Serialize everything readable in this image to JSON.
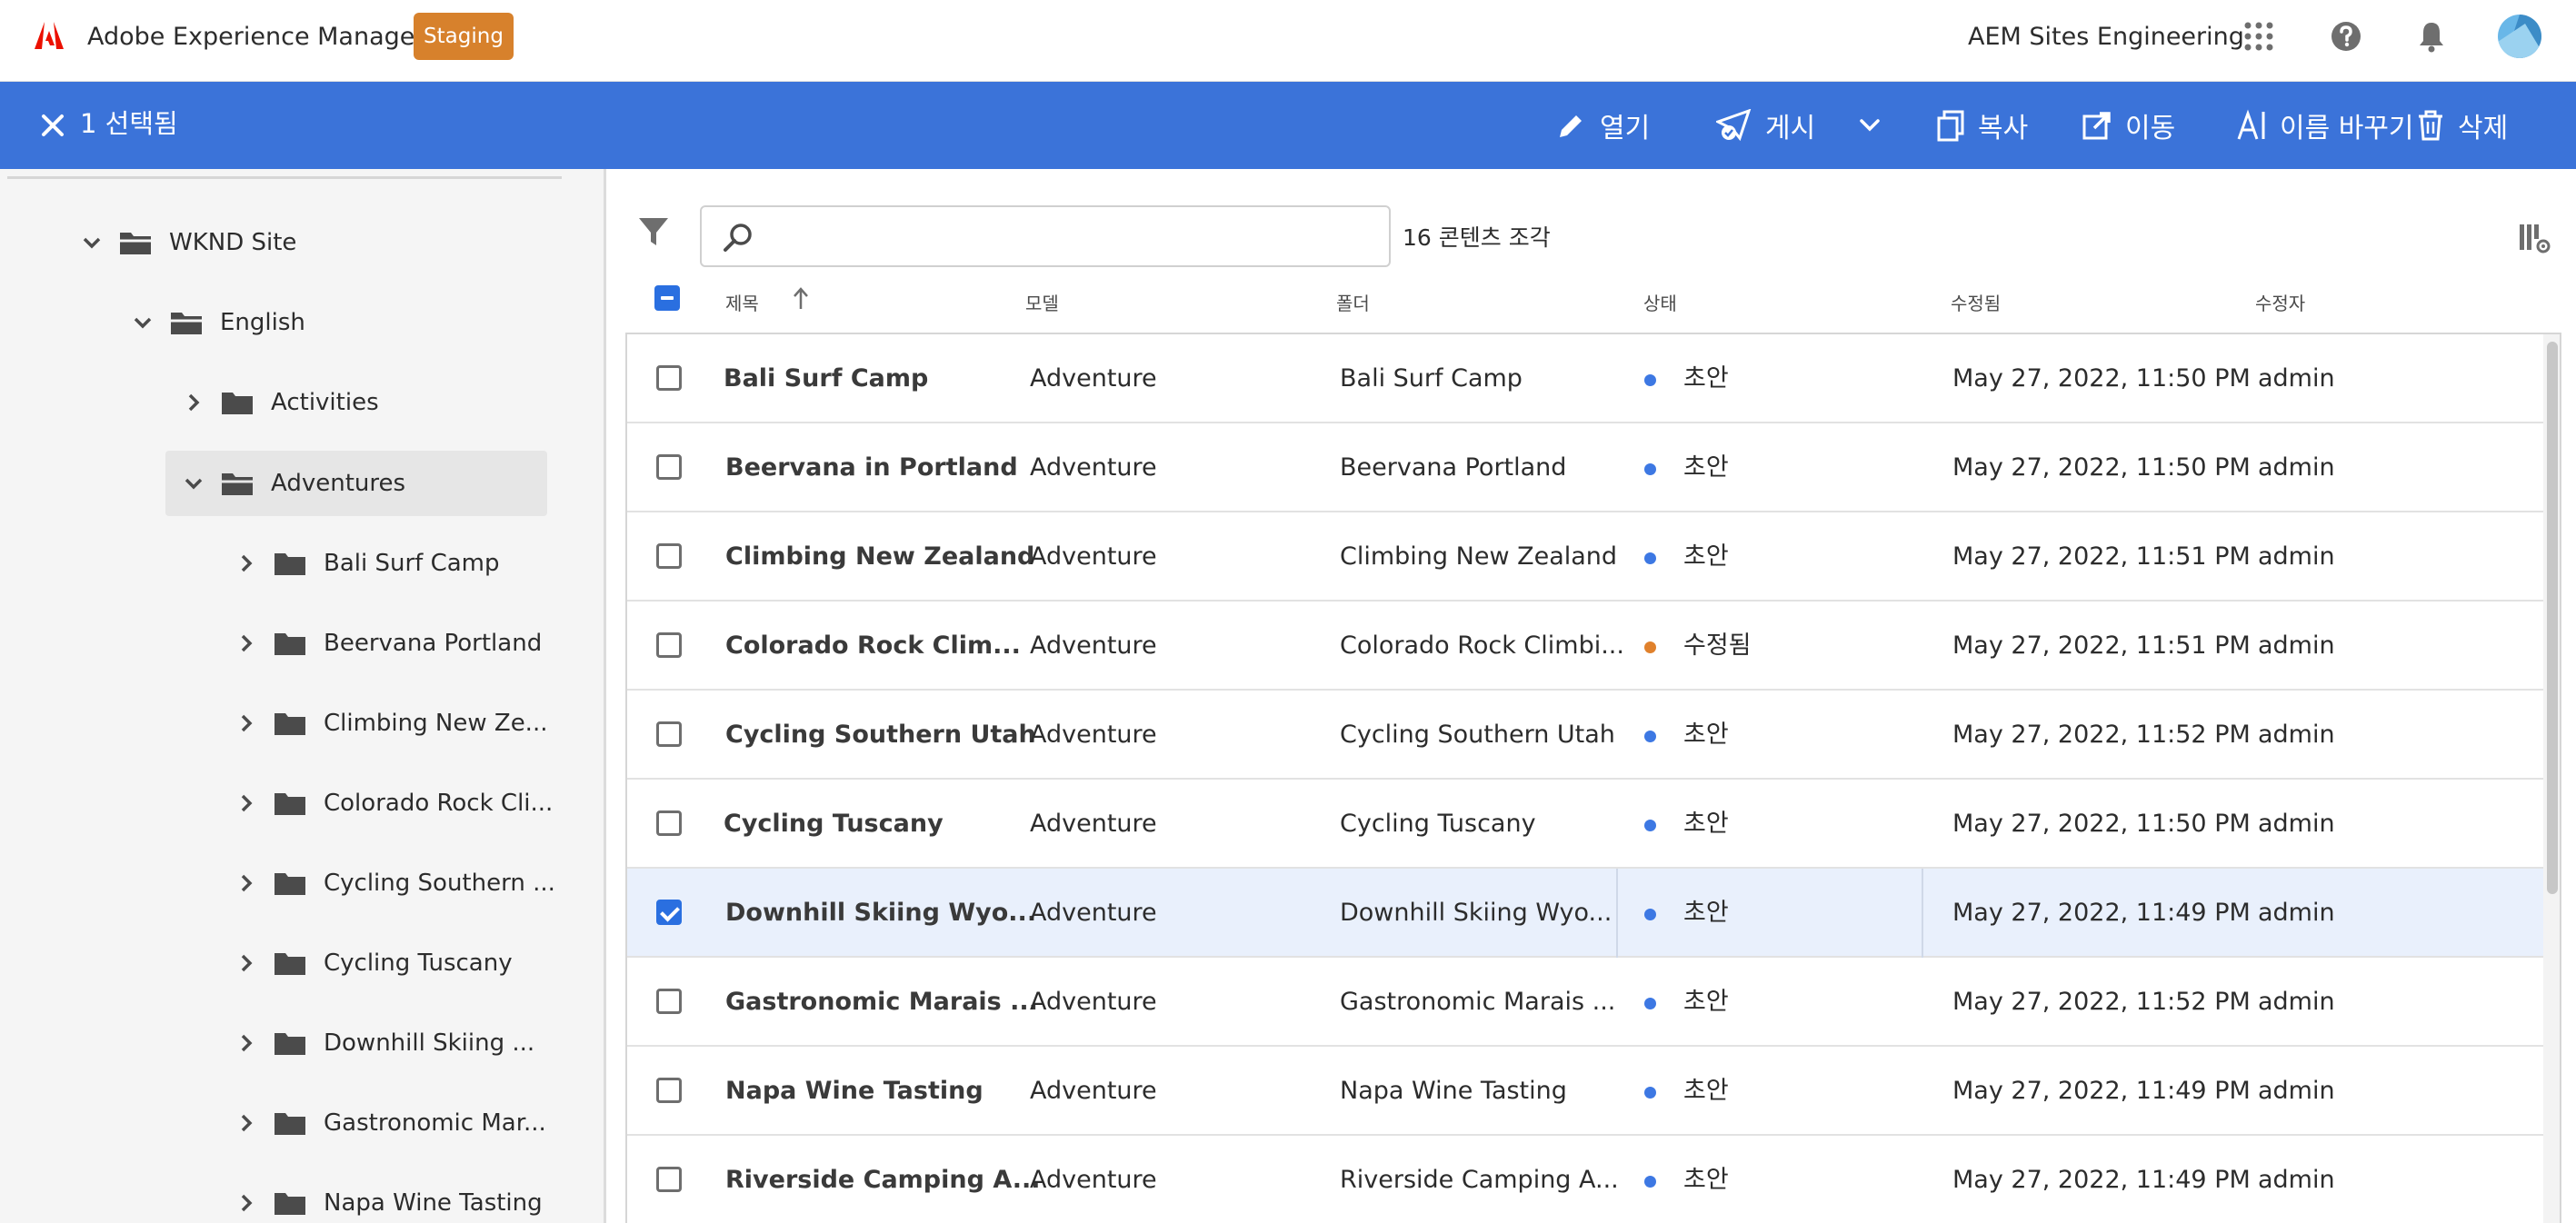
{
  "shell": {
    "app_name": "Adobe Experience Manager",
    "environment": "Staging",
    "org_name": "AEM Sites Engineering",
    "env_color": "#d7812c"
  },
  "actionbar": {
    "selected": "1 선택됨",
    "open": "열기",
    "publish": "게시",
    "copy": "복사",
    "move": "이동",
    "rename": "이름 바꾸기",
    "delete": "삭제",
    "color": "#3b73d9"
  },
  "tree": {
    "root": "WKND Site",
    "language": "English",
    "items": [
      {
        "label": "Activities"
      },
      {
        "label": "Adventures"
      },
      {
        "label": "Bali Surf Camp"
      },
      {
        "label": "Beervana Portland"
      },
      {
        "label": "Climbing New Ze..."
      },
      {
        "label": "Colorado Rock Cli..."
      },
      {
        "label": "Cycling Southern ..."
      },
      {
        "label": "Cycling Tuscany"
      },
      {
        "label": "Downhill Skiing ..."
      },
      {
        "label": "Gastronomic Mar..."
      },
      {
        "label": "Napa Wine Tasting"
      }
    ]
  },
  "search": {
    "placeholder": "",
    "count": "16 콘텐츠 조각"
  },
  "table": {
    "headers": {
      "title": "제목",
      "model": "모델",
      "folder": "폴더",
      "status": "상태",
      "modified": "수정됨",
      "modified_by": "수정자"
    },
    "rows": [
      {
        "title": "Bali Surf Camp",
        "model": "Adventure",
        "folder": "Bali Surf Camp",
        "status": "초안",
        "modified": "May 27, 2022, 11:50 PM",
        "by": "admin"
      },
      {
        "title": "Beervana in Portland",
        "model": "Adventure",
        "folder": "Beervana Portland",
        "status": "초안",
        "modified": "May 27, 2022, 11:50 PM",
        "by": "admin"
      },
      {
        "title": "Climbing New Zealand",
        "model": "Adventure",
        "folder": "Climbing New Zealand",
        "status": "초안",
        "modified": "May 27, 2022, 11:51 PM",
        "by": "admin"
      },
      {
        "title": "Colorado Rock Clim...",
        "model": "Adventure",
        "folder": "Colorado Rock Climbi...",
        "status": "수정됨",
        "modified": "May 27, 2022, 11:51 PM",
        "by": "admin"
      },
      {
        "title": "Cycling Southern Utah",
        "model": "Adventure",
        "folder": "Cycling Southern Utah",
        "status": "초안",
        "modified": "May 27, 2022, 11:52 PM",
        "by": "admin"
      },
      {
        "title": "Cycling Tuscany",
        "model": "Adventure",
        "folder": "Cycling Tuscany",
        "status": "초안",
        "modified": "May 27, 2022, 11:50 PM",
        "by": "admin"
      },
      {
        "title": "Downhill Skiing Wyo...",
        "model": "Adventure",
        "folder": "Downhill Skiing Wyo...",
        "status": "초안",
        "modified": "May 27, 2022, 11:49 PM",
        "by": "admin"
      },
      {
        "title": "Gastronomic Marais ...",
        "model": "Adventure",
        "folder": "Gastronomic Marais ...",
        "status": "초안",
        "modified": "May 27, 2022, 11:52 PM",
        "by": "admin"
      },
      {
        "title": "Napa Wine Tasting",
        "model": "Adventure",
        "folder": "Napa Wine Tasting",
        "status": "초안",
        "modified": "May 27, 2022, 11:49 PM",
        "by": "admin"
      },
      {
        "title": "Riverside Camping A...",
        "model": "Adventure",
        "folder": "Riverside Camping A...",
        "status": "초안",
        "modified": "May 27, 2022, 11:49 PM",
        "by": "admin"
      }
    ],
    "status_colors": {
      "draft": "#3d78e3",
      "modified": "#e0812c"
    }
  }
}
